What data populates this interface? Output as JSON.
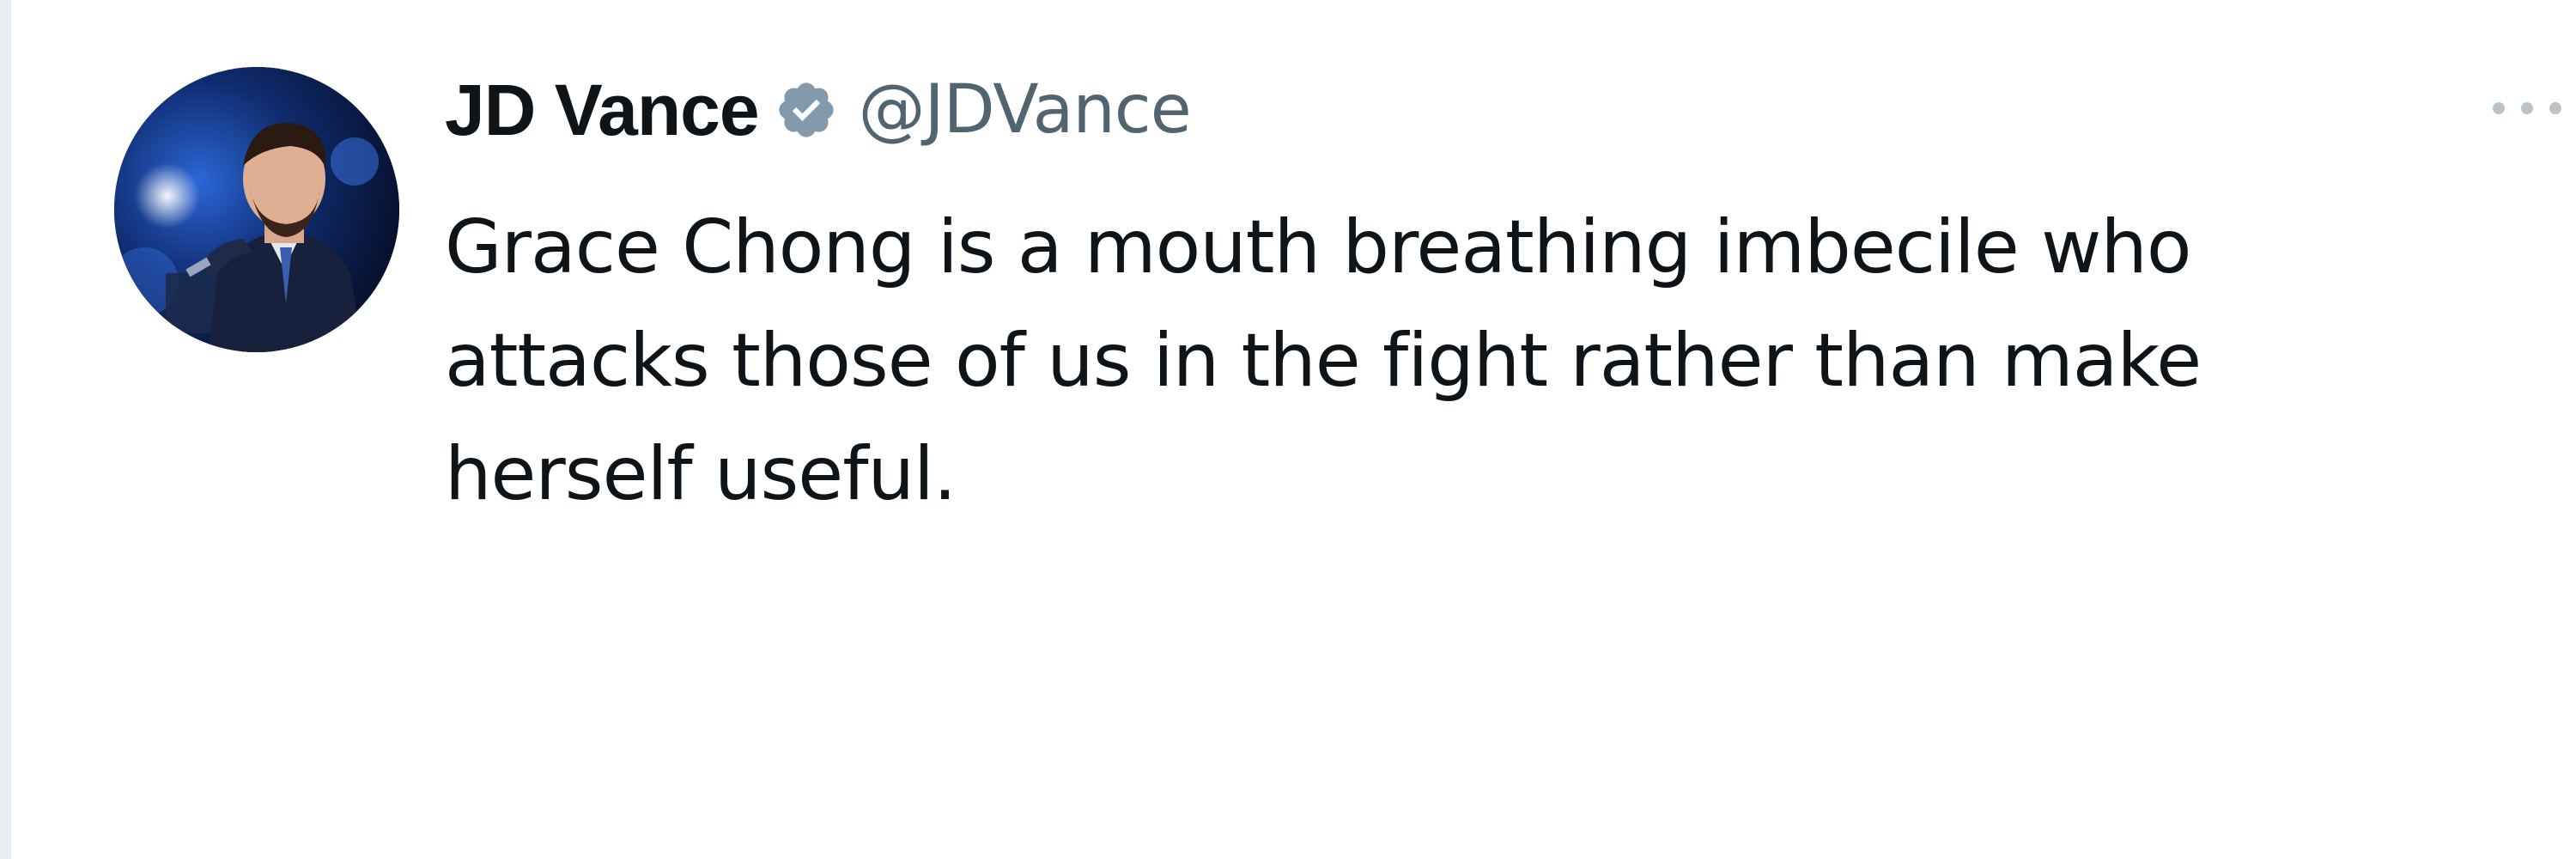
{
  "tweet": {
    "author": {
      "display_name": "JD Vance",
      "handle": "@JDVance",
      "verified_icon": "verified-badge-icon",
      "avatar": "profile-photo"
    },
    "text_lines": [
      "Grace Chong is a mouth breathing imbecile who",
      "attacks those of us in the fight rather than make",
      "herself useful."
    ],
    "more_icon": "more-options-icon"
  },
  "colors": {
    "name": "#0f1419",
    "handle": "#536471",
    "badge": "#829aab",
    "left_strip": "#e9edf1"
  }
}
